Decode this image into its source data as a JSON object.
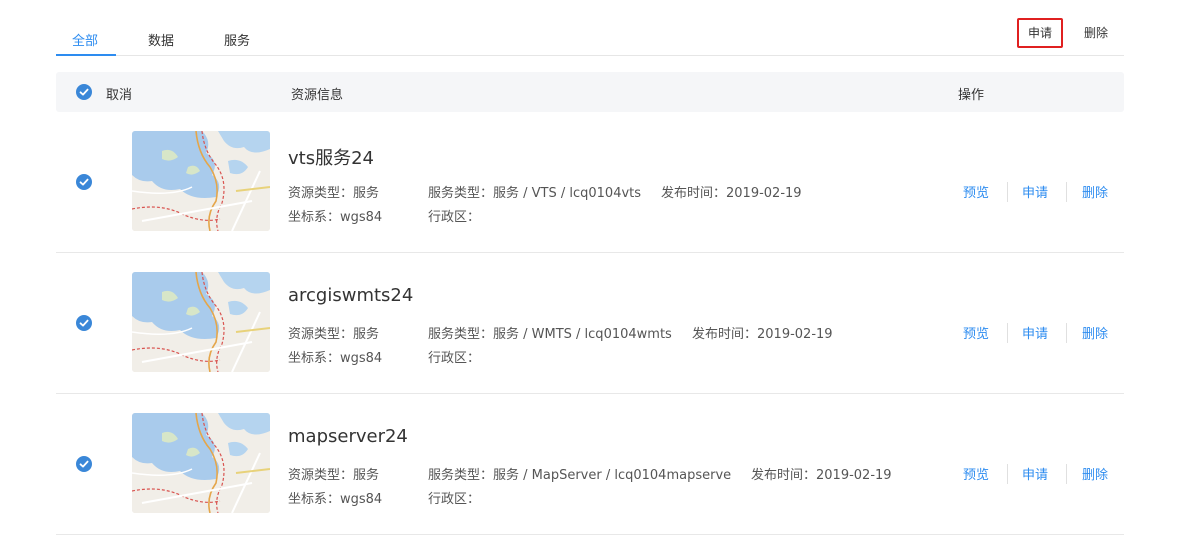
{
  "tabs": [
    "全部",
    "数据",
    "服务"
  ],
  "active_tab": "全部",
  "toolbar": {
    "apply_label": "申请",
    "delete_label": "删除"
  },
  "header": {
    "cancel_label": "取消",
    "info_label": "资源信息",
    "ops_label": "操作"
  },
  "rows": [
    {
      "title": "vts服务24",
      "resource_type": "资源类型：服务",
      "service_type": "服务类型：服务 / VTS / lcq0104vts",
      "publish_time": "发布时间：2019-02-19",
      "crs": "坐标系：wgs84",
      "region": "行政区：",
      "ops": [
        "预览",
        "申请",
        "删除"
      ],
      "checked": true
    },
    {
      "title": "arcgiswmts24",
      "resource_type": "资源类型：服务",
      "service_type": "服务类型：服务 / WMTS / lcq0104wmts",
      "publish_time": "发布时间：2019-02-19",
      "crs": "坐标系：wgs84",
      "region": "行政区：",
      "ops": [
        "预览",
        "申请",
        "删除"
      ],
      "checked": true
    },
    {
      "title": "mapserver24",
      "resource_type": "资源类型：服务",
      "service_type": "服务类型：服务 / MapServer / lcq0104mapserve",
      "publish_time": "发布时间：2019-02-19",
      "crs": "坐标系：wgs84",
      "region": "行政区：",
      "ops": [
        "预览",
        "申请",
        "删除"
      ],
      "checked": true
    }
  ],
  "colors": {
    "accent": "#2d8cf0",
    "check": "#3a87d8",
    "highlight_border": "#e02020"
  }
}
